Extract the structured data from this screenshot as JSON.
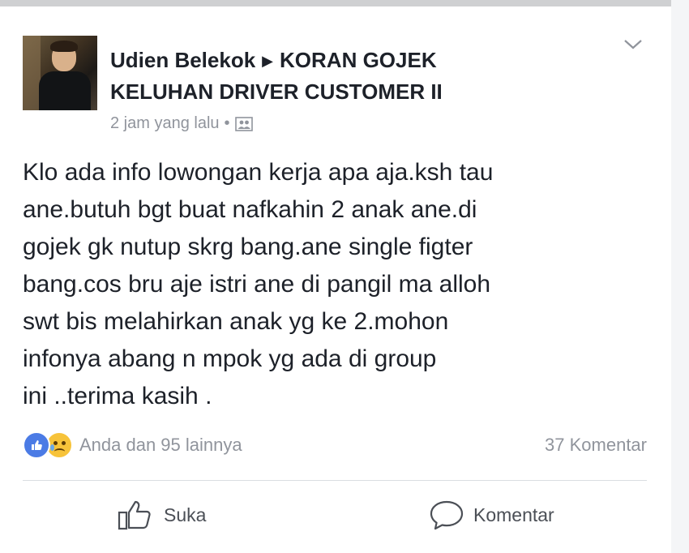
{
  "post": {
    "author": "Udien Belekok",
    "group": "KORAN GOJEK",
    "group_line2": "KELUHAN DRIVER CUSTOMER II",
    "timestamp": "2 jam yang lalu",
    "separator": "•",
    "text": "Klo ada info lowongan kerja apa aja.ksh tau\nane.butuh bgt buat nafkahin 2 anak ane.di\ngojek gk nutup skrg bang.ane single figter\nbang.cos bru aje istri ane di pangil ma alloh\nswt bis melahirkan anak yg ke 2.mohon\ninfonya abang n mpok yg ada di group\nini ..terima kasih .",
    "reactions_text": "Anda dan 95 lainnya",
    "comments_count": "37 Komentar"
  },
  "actions": {
    "like_label": "Suka",
    "comment_label": "Komentar"
  },
  "icons": {
    "arrow": "right-triangle-icon",
    "menu": "chevron-down-icon",
    "audience": "group-audience-icon",
    "like_reaction": "like-reaction-icon",
    "sad_reaction": "sad-reaction-icon",
    "like_action": "thumbs-up-icon",
    "comment_action": "speech-bubble-icon"
  },
  "colors": {
    "text": "#1d2129",
    "muted": "#90949c",
    "like_blue": "#4b7be5",
    "sad_yellow": "#f7c33a"
  }
}
